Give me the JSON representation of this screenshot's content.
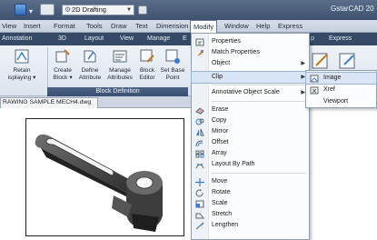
{
  "titlebar": {
    "workspace": "2D Drafting",
    "app_title": "GstarCAD 20"
  },
  "menubar": [
    "View",
    "Insert",
    "Format",
    "Tools",
    "Draw",
    "Text",
    "Dimension",
    "Modify",
    "Window",
    "Help",
    "Express"
  ],
  "ribbon_tabs": [
    "Annotation",
    "3D",
    "Layout",
    "View",
    "Manage",
    "E",
    "p",
    "Express"
  ],
  "ribbon": {
    "buttons": [
      {
        "label1": "Retain",
        "label2": "isplaying ▾"
      },
      {
        "label1": "Create",
        "label2": "Block ▾"
      },
      {
        "label1": "Define",
        "label2": "Attribute"
      },
      {
        "label1": "Manage",
        "label2": "Attributes"
      },
      {
        "label1": "Block",
        "label2": "Editor"
      },
      {
        "label1": "Set Base",
        "label2": "Point"
      }
    ],
    "panel_title": "Block Definition"
  },
  "document_tab": "RAWING SAMPLE MECH4.dwg",
  "modify_menu": {
    "items": [
      "Properties",
      "Match Properties",
      "Object",
      "Clip",
      "Annotative Object Scale",
      "Erase",
      "Copy",
      "Mirror",
      "Offset",
      "Array",
      "Layout By Path",
      "Move",
      "Rotate",
      "Scale",
      "Stretch",
      "Lengthen"
    ],
    "highlighted": "Clip"
  },
  "clip_submenu": {
    "items": [
      "Image",
      "Xref",
      "Viewport"
    ],
    "highlighted": "Image"
  },
  "colors": {
    "titlebar": "#46597a",
    "ribbon_tab_bg": "#344a66",
    "menu_highlight": "#d9e5f5",
    "panel_title_bar": "#3a5072"
  }
}
